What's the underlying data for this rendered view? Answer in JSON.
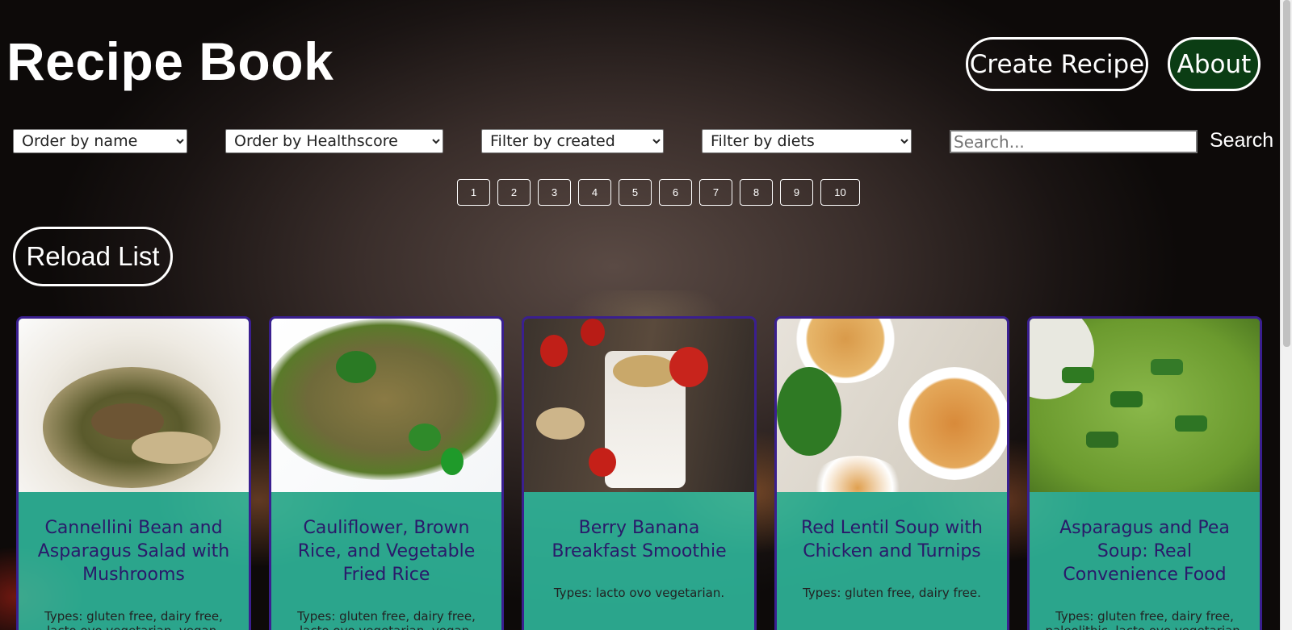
{
  "header": {
    "title": "Recipe Book",
    "create_label": "Create Recipe",
    "about_label": "About"
  },
  "filters": {
    "order_name": "Order by name",
    "order_health": "Order by Healthscore",
    "filter_created": "Filter by created",
    "filter_diets": "Filter by diets",
    "search_placeholder": "Search...",
    "search_label": "Search"
  },
  "pagination": [
    "1",
    "2",
    "3",
    "4",
    "5",
    "6",
    "7",
    "8",
    "9",
    "10"
  ],
  "reload_label": "Reload List",
  "recipes": [
    {
      "name": "Cannellini Bean and Asparagus Salad with Mushrooms",
      "types": "Types: gluten free, dairy free, lacto ovo vegetarian, vegan."
    },
    {
      "name": "Cauliflower, Brown Rice, and Vegetable Fried Rice",
      "types": "Types: gluten free, dairy free, lacto ovo vegetarian, vegan."
    },
    {
      "name": "Berry Banana Breakfast Smoothie",
      "types": "Types: lacto ovo vegetarian."
    },
    {
      "name": "Red Lentil Soup with Chicken and Turnips",
      "types": "Types: gluten free, dairy free."
    },
    {
      "name": "Asparagus and Pea Soup: Real Convenience Food",
      "types": "Types: gluten free, dairy free, paleolithic, lacto ovo vegetarian,"
    }
  ],
  "colors": {
    "card_bg": "#32c8aa",
    "card_border": "#3a1f8f",
    "card_title": "#2a1a6a",
    "about_bg": "#0b3d14"
  }
}
